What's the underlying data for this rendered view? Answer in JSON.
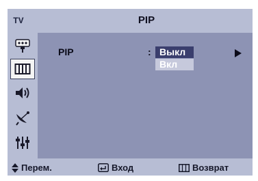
{
  "header": {
    "source_label": "TV",
    "title": "PIP"
  },
  "sidebar": {
    "items": [
      {
        "icon": "input-source-icon",
        "active": false
      },
      {
        "icon": "picture-icon",
        "active": true
      },
      {
        "icon": "sound-icon",
        "active": false
      },
      {
        "icon": "channel-icon",
        "active": false
      },
      {
        "icon": "setup-icon",
        "active": false
      }
    ]
  },
  "menu": {
    "rows": [
      {
        "label": "PIP",
        "separator": ":",
        "options": [
          "Выкл",
          "Вкл"
        ],
        "selected": "Выкл"
      }
    ]
  },
  "footer": {
    "move_label": "Перем.",
    "enter_label": "Вход",
    "return_label": "Возврат"
  },
  "colors": {
    "panel": "#b7bdd4",
    "content": "#8d93b4",
    "highlight": "#3a3e6d"
  }
}
